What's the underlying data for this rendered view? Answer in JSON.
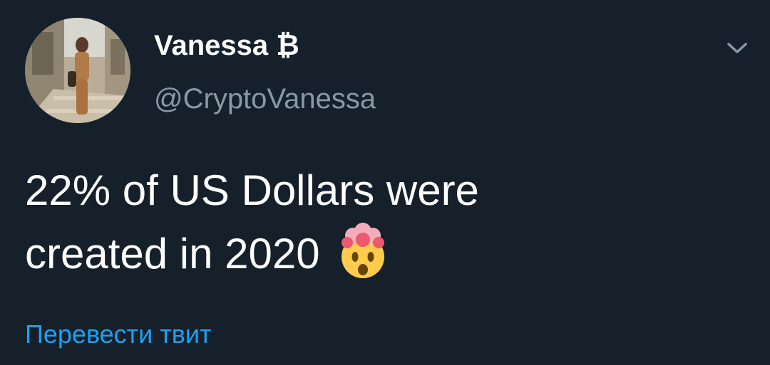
{
  "author": {
    "display_name": "Vanessa ₿",
    "handle": "@CryptoVanessa",
    "avatar_icon": "profile-photo"
  },
  "tweet": {
    "line1": "22% of US Dollars were",
    "line2": "created in 2020",
    "emoji_icon": "exploding-head-emoji"
  },
  "actions": {
    "translate_label": "Перевести твит",
    "menu_icon": "chevron-down-icon"
  },
  "colors": {
    "background": "#15202b",
    "text": "#ffffff",
    "secondary_text": "#8899a6",
    "link": "#1da1f2"
  }
}
